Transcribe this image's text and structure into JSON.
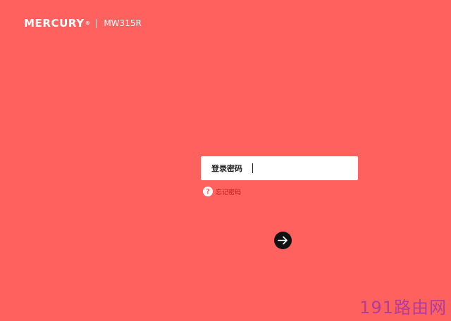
{
  "header": {
    "brand": "MERCURY",
    "trademark": "®",
    "model": "MW315R"
  },
  "login": {
    "label": "登录密码",
    "password_value": "",
    "forgot_label": "忘记密码",
    "help_symbol": "?"
  },
  "icons": {
    "help": "question-mark-icon",
    "submit": "arrow-right-icon"
  },
  "colors": {
    "background": "#ff615f",
    "button": "#111111",
    "forgot_text": "#b81a1a",
    "watermark": "#b23b9c"
  },
  "watermark": "191路由网"
}
